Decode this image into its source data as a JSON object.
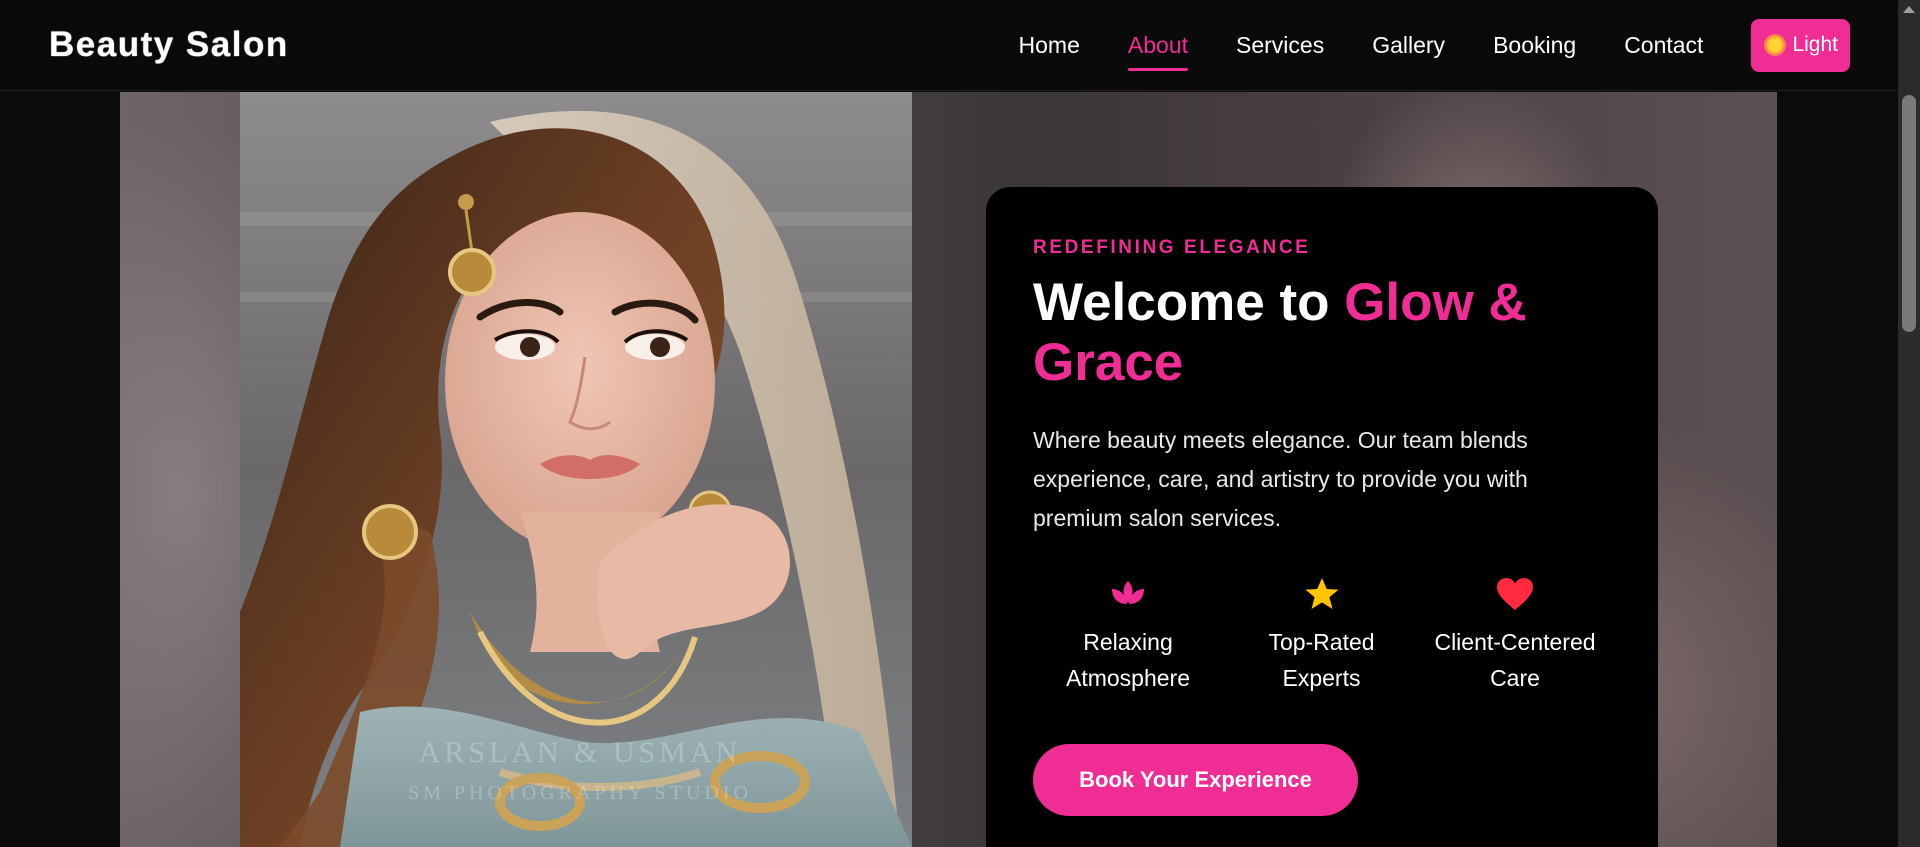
{
  "brand": "Beauty Salon",
  "nav": {
    "items": [
      "Home",
      "About",
      "Services",
      "Gallery",
      "Booking",
      "Contact"
    ],
    "active": "About",
    "theme_toggle": {
      "label": "Light",
      "icon": "sun-icon"
    }
  },
  "hero": {
    "eyebrow": "REDEFINING ELEGANCE",
    "title_prefix": "Welcome to ",
    "title_accent": "Glow & Grace",
    "description": "Where beauty meets elegance. Our team blends experience, care, and artistry to provide you with premium salon services.",
    "features": [
      {
        "icon": "lotus-icon",
        "label": "Relaxing Atmosphere"
      },
      {
        "icon": "star-icon",
        "label": "Top-Rated Experts"
      },
      {
        "icon": "heart-icon",
        "label": "Client-Centered Care"
      }
    ],
    "cta_label": "Book Your Experience",
    "photo_watermark_line1": "ARSLAN & USMAN",
    "photo_watermark_line2": "SM PHOTOGRAPHY STUDIO"
  },
  "colors": {
    "accent": "#f02c95",
    "background": "#0b0b0b",
    "card": "#000000",
    "star": "#ffc400",
    "heart": "#ff2a3f"
  }
}
